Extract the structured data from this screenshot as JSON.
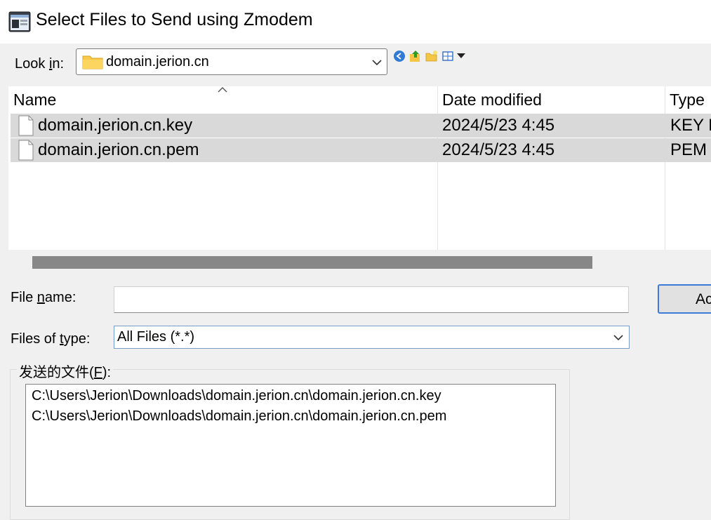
{
  "window": {
    "title": "Select Files to Send using Zmodem"
  },
  "look_in": {
    "label_pre": "Look ",
    "label_accel": "i",
    "label_post": "n:",
    "value": "domain.jerion.cn"
  },
  "toolbar": {
    "icons": [
      "back-icon",
      "up-folder-icon",
      "new-folder-icon",
      "view-menu-icon"
    ]
  },
  "file_list": {
    "columns": [
      "Name",
      "Date modified",
      "Type"
    ],
    "rows": [
      {
        "name": "domain.jerion.cn.key",
        "date": "2024/5/23 4:45",
        "type": "KEY F"
      },
      {
        "name": "domain.jerion.cn.pem",
        "date": "2024/5/23 4:45",
        "type": "PEM"
      }
    ]
  },
  "file_name": {
    "label_pre": "File ",
    "label_accel": "n",
    "label_post": "ame:",
    "value": ""
  },
  "accept_button": {
    "label": "Ac"
  },
  "file_type": {
    "label_pre": "Files of ",
    "label_accel": "t",
    "label_post": "ype:",
    "value": "All Files (*.*)"
  },
  "files_to_send": {
    "label_pre": "发送的文件(",
    "label_accel": "F",
    "label_post": "):",
    "items": [
      "C:\\Users\\Jerion\\Downloads\\domain.jerion.cn\\domain.jerion.cn.key",
      "C:\\Users\\Jerion\\Downloads\\domain.jerion.cn\\domain.jerion.cn.pem"
    ]
  },
  "colors": {
    "selection_row": "#d9d9d9",
    "button_focus": "#3b7ad8",
    "folder": "#f8c94a"
  }
}
